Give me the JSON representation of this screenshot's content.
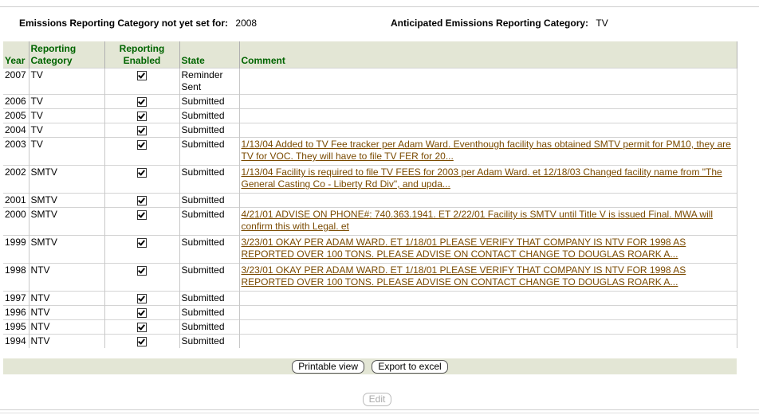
{
  "summary": {
    "not_set_label": "Emissions Reporting Category not yet set for:",
    "not_set_value": "2008",
    "anticipated_label": "Anticipated Emissions Reporting Category:",
    "anticipated_value": "TV"
  },
  "table": {
    "headers": {
      "year": "Year",
      "category": "Reporting Category",
      "enabled": "Reporting Enabled",
      "state": "State",
      "comment": "Comment"
    },
    "rows": [
      {
        "year": "2007",
        "category": "TV",
        "enabled": true,
        "state": "Reminder Sent",
        "comment": ""
      },
      {
        "year": "2006",
        "category": "TV",
        "enabled": true,
        "state": "Submitted",
        "comment": ""
      },
      {
        "year": "2005",
        "category": "TV",
        "enabled": true,
        "state": "Submitted",
        "comment": ""
      },
      {
        "year": "2004",
        "category": "TV",
        "enabled": true,
        "state": "Submitted",
        "comment": ""
      },
      {
        "year": "2003",
        "category": "TV",
        "enabled": true,
        "state": "Submitted",
        "comment": "1/13/04 Added to TV Fee tracker per Adam Ward. Eventhough facility has obtained SMTV permit for PM10, they are TV for VOC. They will have to file TV FER for 20..."
      },
      {
        "year": "2002",
        "category": "SMTV",
        "enabled": true,
        "state": "Submitted",
        "comment": "1/13/04 Facility is required to file TV FEES for 2003 per Adam Ward. et 12/18/03 Changed facility name from \"The General Casting Co - Liberty Rd Div\", and upda..."
      },
      {
        "year": "2001",
        "category": "SMTV",
        "enabled": true,
        "state": "Submitted",
        "comment": ""
      },
      {
        "year": "2000",
        "category": "SMTV",
        "enabled": true,
        "state": "Submitted",
        "comment": "4/21/01 ADVISE ON PHONE#: 740.363.1941. ET 2/22/01 Facility is SMTV until Title V is issued Final. MWA will confirm this with Legal. et"
      },
      {
        "year": "1999",
        "category": "SMTV",
        "enabled": true,
        "state": "Submitted",
        "comment": "3/23/01 OKAY PER ADAM WARD. ET 1/18/01 PLEASE VERIFY THAT COMPANY IS NTV FOR 1998 AS REPORTED OVER 100 TONS. PLEASE ADVISE ON CONTACT CHANGE TO DOUGLAS ROARK A..."
      },
      {
        "year": "1998",
        "category": "NTV",
        "enabled": true,
        "state": "Submitted",
        "comment": "3/23/01 OKAY PER ADAM WARD. ET 1/18/01 PLEASE VERIFY THAT COMPANY IS NTV FOR 1998 AS REPORTED OVER 100 TONS. PLEASE ADVISE ON CONTACT CHANGE TO DOUGLAS ROARK A..."
      },
      {
        "year": "1997",
        "category": "NTV",
        "enabled": true,
        "state": "Submitted",
        "comment": ""
      },
      {
        "year": "1996",
        "category": "NTV",
        "enabled": true,
        "state": "Submitted",
        "comment": ""
      },
      {
        "year": "1995",
        "category": "NTV",
        "enabled": true,
        "state": "Submitted",
        "comment": ""
      },
      {
        "year": "1994",
        "category": "NTV",
        "enabled": true,
        "state": "Submitted",
        "comment": ""
      }
    ]
  },
  "buttons": {
    "printable": "Printable view",
    "export": "Export to excel",
    "edit": "Edit"
  },
  "colors": {
    "header_bg": "#e3e6d5",
    "header_text": "#006400",
    "link": "#7a4a00"
  }
}
